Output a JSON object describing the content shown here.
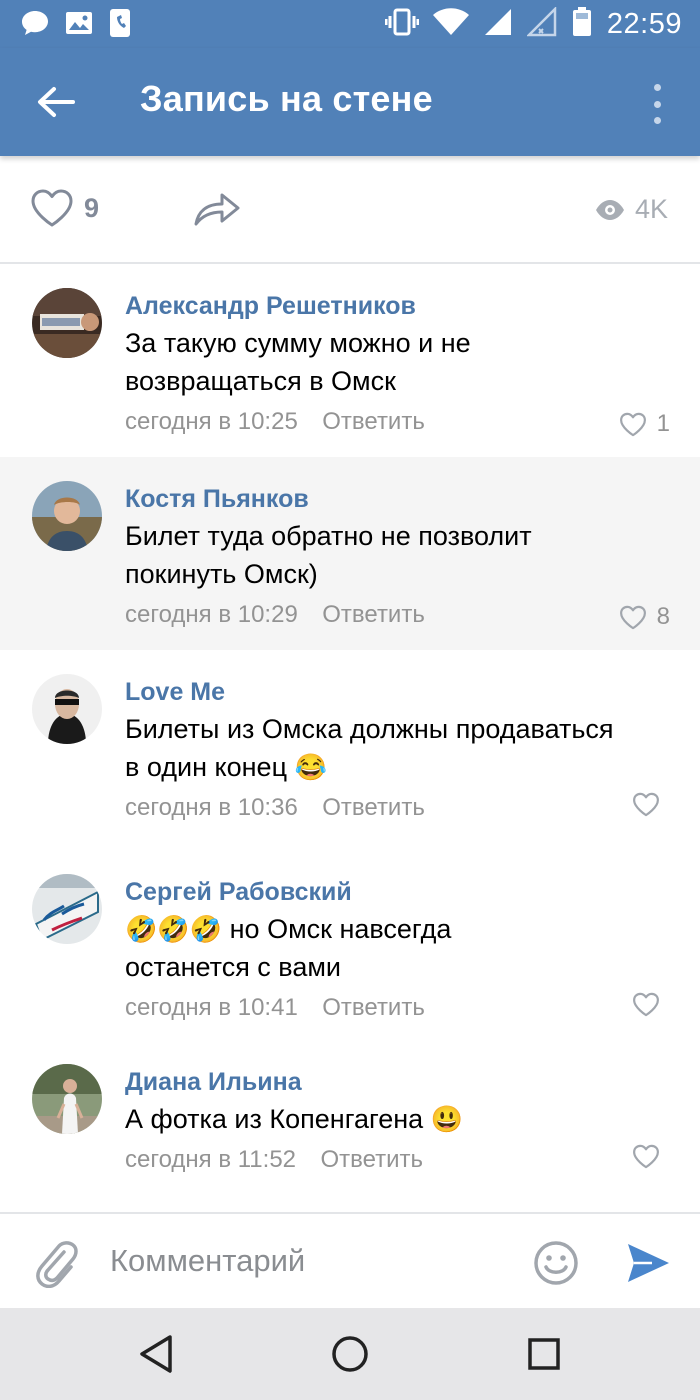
{
  "status_bar": {
    "time": "22:59",
    "left_icons": [
      "chat-bubble-icon",
      "image-icon",
      "phone-notification-icon"
    ],
    "right_icons": [
      "vibrate-icon",
      "wifi-icon",
      "signal-icon",
      "signal-empty-icon",
      "battery-icon"
    ]
  },
  "app_bar": {
    "title": "Запись на стене",
    "back_icon": "arrow-left-icon",
    "menu_icon": "more-vertical-icon",
    "color": "#5181b8"
  },
  "actions": {
    "likes": "9",
    "views": "4K"
  },
  "comments": [
    {
      "author": "Александр Решетников",
      "text_lines": [
        "За такую сумму можно и не",
        "возвращаться в Омск"
      ],
      "date": "сегодня в 10:25",
      "reply": "Ответить",
      "likes": "1",
      "highlighted": false
    },
    {
      "author": "Костя Пьянков",
      "text_lines": [
        "Билет туда обратно не позволит",
        "покинуть Омск)"
      ],
      "date": "сегодня в 10:29",
      "reply": "Ответить",
      "likes": "8",
      "highlighted": true
    },
    {
      "author": "Love Me",
      "text_lines": [
        "Билеты из Омска должны продаваться",
        "в один конец"
      ],
      "text_emoji": "😂",
      "date": "сегодня в 10:36",
      "reply": "Ответить",
      "likes": "",
      "highlighted": false
    },
    {
      "author": "Сергей Рабовский",
      "text_lines": [
        "но Омск навсегда",
        "останется с вами"
      ],
      "text_emoji": "🤣🤣🤣",
      "date": "сегодня в 10:41",
      "reply": "Ответить",
      "likes": "",
      "highlighted": false
    },
    {
      "author": "Диана Ильина",
      "text_lines": [
        "А фотка из Копенгагена"
      ],
      "text_emoji": "😃",
      "date": "сегодня в 11:52",
      "reply": "Ответить",
      "likes": "",
      "highlighted": false
    }
  ],
  "composer": {
    "placeholder": "Комментарий"
  },
  "colors": {
    "accent": "#5181b8",
    "author_link": "#4a76a8",
    "meta_text": "#939393",
    "send_icon": "#4a86cc"
  }
}
